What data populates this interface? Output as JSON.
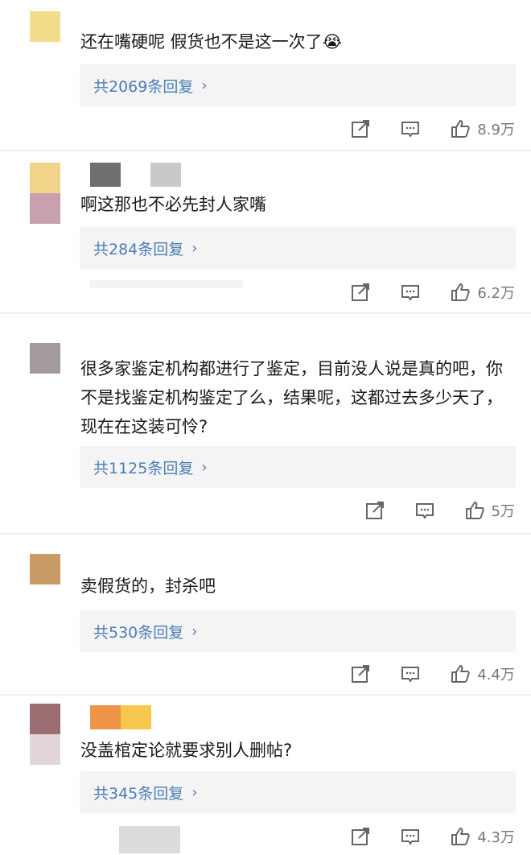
{
  "comments": [
    {
      "text": "还在嘴硬呢 假货也不是这一次了😭",
      "reply_label": "共2069条回复",
      "likes": "8.9万",
      "avatar_colors": [
        "#f3dc8c"
      ],
      "name_colors": []
    },
    {
      "text": "啊这那也不必先封人家嘴",
      "reply_label": "共284条回复",
      "likes": "6.2万",
      "avatar_colors": [
        "#f1d38a",
        "#c8a0ae"
      ],
      "name_colors": [
        "#6f6f6f",
        "#c9c9c9"
      ]
    },
    {
      "text": "很多家鉴定机构都进行了鉴定，目前没人说是真的吧，你不是找鉴定机构鉴定了么，结果呢，这都过去多少天了，现在在这装可怜?",
      "reply_label": "共1125条回复",
      "likes": "5万",
      "avatar_colors": [
        "#a39a9e"
      ],
      "name_colors": []
    },
    {
      "text": "卖假货的，封杀吧",
      "reply_label": "共530条回复",
      "likes": "4.4万",
      "avatar_colors": [
        "#c79a66"
      ],
      "name_colors": []
    },
    {
      "text": "没盖棺定论就要求别人删帖?",
      "reply_label": "共345条回复",
      "likes": "4.3万",
      "avatar_colors": [
        "#9a6e70",
        "#e2d6d8"
      ],
      "name_colors": [
        "#ef9448",
        "#f7c84e"
      ]
    }
  ],
  "icons": {
    "share": "share-icon",
    "comment": "comment-icon",
    "like": "like-icon"
  },
  "colors": {
    "reply_link": "#4a7eb5",
    "reply_bg": "#f4f4f4",
    "meta_text": "#777777"
  }
}
